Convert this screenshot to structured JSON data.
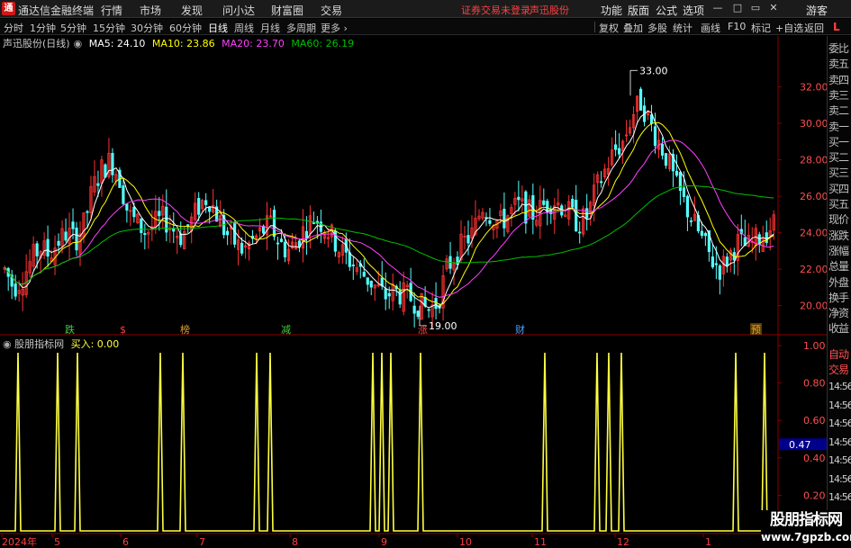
{
  "menubar": {
    "app_title": "通达信金融终端",
    "menus": [
      "行情",
      "市场",
      "发现",
      "问小达",
      "财富圈",
      "交易"
    ],
    "notice": "证券交易未登录",
    "stock_name": "声迅股份",
    "tools": [
      "功能",
      "版面",
      "公式",
      "选项"
    ],
    "user": "游客"
  },
  "periodbar": {
    "periods": [
      "分时",
      "1分钟",
      "5分钟",
      "15分钟",
      "30分钟",
      "60分钟",
      "日线",
      "周线",
      "月线",
      "多周期",
      "更多"
    ],
    "active_period": "日线",
    "right_buttons": [
      "复权",
      "叠加",
      "多股",
      "统计",
      "画线",
      "F10",
      "标记",
      "+自选",
      "返回"
    ]
  },
  "info": {
    "title": "声迅股份(日线)",
    "ma5": "MA5: 24.10",
    "ma10": "MA10: 23.86",
    "ma20": "MA20: 23.70",
    "ma60": "MA60: 26.19"
  },
  "indicator": {
    "name": "股朋指标网",
    "value": "买入: 0.00"
  },
  "right_panel": {
    "top": "L",
    "items": [
      "委比",
      "卖五",
      "卖四",
      "卖三",
      "卖二",
      "卖一",
      "买一",
      "买二",
      "买三",
      "买四",
      "买五",
      "现价",
      "涨跌",
      "涨幅",
      "总量",
      "外盘",
      "换手",
      "净资",
      "收益",
      "自动",
      "交易",
      "14:56",
      "14:56",
      "14:56",
      "14:56",
      "14:56",
      "14:56",
      "14:56",
      "14:56",
      "14:56"
    ]
  },
  "main_axis": {
    "labels": [
      "32.00",
      "30.00",
      "28.00",
      "26.00",
      "24.00",
      "22.00",
      "20.00"
    ]
  },
  "ind_axis": {
    "labels": [
      "1.00",
      "0.80",
      "0.60",
      "0.40",
      "0.20"
    ],
    "current": "0.47"
  },
  "date_labels": [
    "2024年",
    "5",
    "6",
    "7",
    "8",
    "9",
    "10",
    "11",
    "12",
    "1"
  ],
  "event_markers": [
    {
      "text": "跌",
      "color": "#3ecf3e"
    },
    {
      "text": "$",
      "color": "#ff4040"
    },
    {
      "text": "榜",
      "color": "#e0a030"
    },
    {
      "text": "减",
      "color": "#3ecf3e"
    },
    {
      "text": "涨",
      "color": "#ff4040"
    },
    {
      "text": "财",
      "color": "#4aa0ff"
    },
    {
      "text": "预",
      "color": "#e0a030"
    }
  ],
  "annotations": {
    "high": "33.00",
    "low": "19.00"
  },
  "watermark": {
    "name": "股朋指标网",
    "url": "www.7gpzb.com"
  },
  "colors": {
    "up": "#ff3232",
    "down": "#54ffff",
    "ma5": "#ffffff",
    "ma10": "#ffff00",
    "ma20": "#ff40ff",
    "ma60": "#00c000",
    "signal": "#ffff40",
    "grid": "#8b0000"
  },
  "chart_data": {
    "type": "line",
    "title": "声迅股份(日线)",
    "y_range": [
      18.5,
      34
    ],
    "close_path": [
      22.0,
      21.0,
      21.5,
      22.5,
      23.2,
      22.8,
      23.5,
      24.0,
      23.6,
      24.5,
      26.5,
      27.5,
      28.0,
      27.0,
      25.0,
      24.5,
      24.0,
      24.5,
      24.8,
      24.2,
      23.8,
      24.5,
      25.5,
      26.0,
      25.0,
      24.0,
      23.5,
      23.0,
      23.5,
      24.0,
      24.5,
      23.5,
      23.0,
      23.5,
      24.3,
      24.8,
      24.5,
      23.8,
      23.0,
      22.5,
      22.0,
      21.5,
      21.0,
      20.5,
      20.8,
      20.6,
      20.4,
      20.0,
      19.8,
      20.2,
      22.0,
      22.8,
      23.5,
      24.0,
      25.5,
      25.0,
      24.5,
      25.0,
      25.5,
      25.2,
      25.0,
      25.5,
      25.8,
      25.5,
      25.0,
      24.5,
      25.0,
      26.5,
      27.5,
      28.5,
      29.0,
      30.5,
      31.2,
      30.0,
      29.0,
      28.0,
      26.5,
      25.5,
      24.5,
      23.5,
      22.5,
      22.0,
      22.8,
      23.5,
      23.2,
      23.6,
      24.0,
      24.5
    ],
    "ma_series": [
      "MA5",
      "MA10",
      "MA20",
      "MA60"
    ],
    "signal_count": 27
  }
}
